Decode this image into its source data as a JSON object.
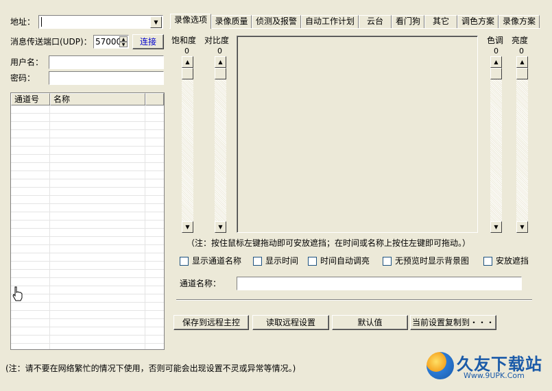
{
  "left": {
    "address_label": "地址：",
    "address_value": "",
    "port_label": "消息传送端口(UDP)：",
    "port_value": "57000",
    "connect_button": "连接",
    "username_label": "用户名：",
    "username_value": "",
    "password_label": "密码：",
    "password_value": ""
  },
  "channel_list": {
    "columns": [
      "通道号",
      "名称"
    ]
  },
  "tabs": [
    {
      "label": "录像选项",
      "active": true
    },
    {
      "label": "录像质量"
    },
    {
      "label": "侦测及报警"
    },
    {
      "label": "自动工作计划"
    },
    {
      "label": "云台"
    },
    {
      "label": "看门狗"
    },
    {
      "label": "其它"
    },
    {
      "label": "调色方案"
    },
    {
      "label": "录像方案"
    }
  ],
  "sliders": {
    "saturation_label": "饱和度",
    "saturation_value": "0",
    "contrast_label": "对比度",
    "contrast_value": "0",
    "hue_label": "色调",
    "hue_value": "0",
    "brightness_label": "亮度",
    "brightness_value": "0"
  },
  "note": "（注：按住鼠标左键拖动即可安放遮挡；在时间或名称上按住左键即可拖动。）",
  "checkboxes": [
    {
      "label": "显示通道名称",
      "checked": false
    },
    {
      "label": "显示时间",
      "checked": false
    },
    {
      "label": "时间自动调亮",
      "checked": false
    },
    {
      "label": "无预览时显示背景图",
      "checked": false
    },
    {
      "label": "安放遮挡",
      "checked": false
    }
  ],
  "channel_name_label": "通道名称：",
  "channel_name_value": "",
  "buttons": {
    "save_remote": "保存到远程主控",
    "read_remote": "读取远程设置",
    "default": "默认值",
    "copy_current": "当前设置复制到・・・"
  },
  "footer_note": "(注：请不要在网络繁忙的情况下使用，否则可能会出现设置不灵或异常等情况。)",
  "watermark": {
    "name": "久友下载站",
    "url": "Www.9UPK.Com"
  },
  "icons": {
    "dropdown": "▼",
    "up": "▲",
    "down": "▼"
  }
}
